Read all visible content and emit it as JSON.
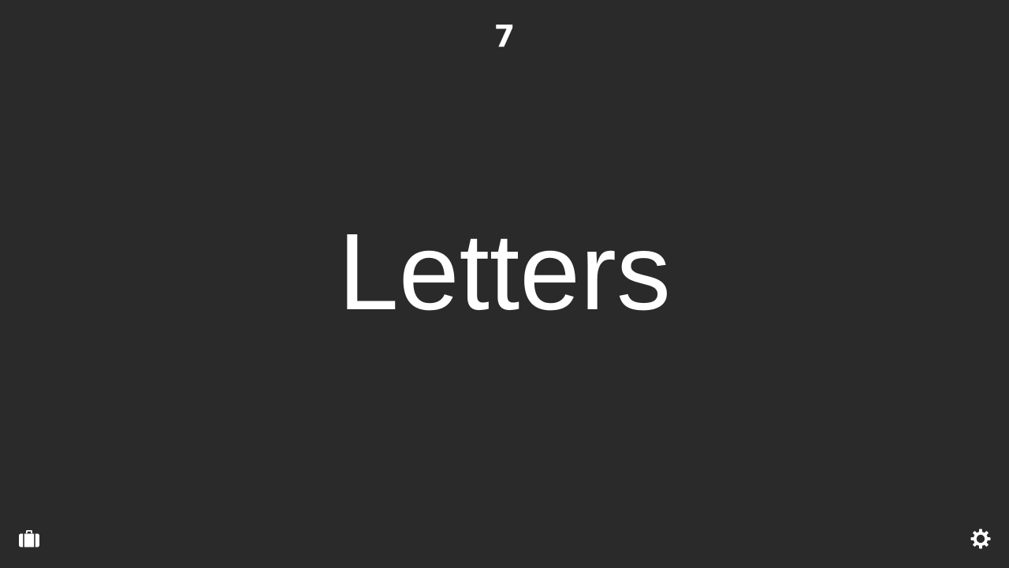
{
  "counter": {
    "value": "7"
  },
  "main": {
    "word": "Letters"
  },
  "controls": {
    "left_icon": "briefcase-icon",
    "right_icon": "gear-icon"
  },
  "colors": {
    "background": "#2a2a2a",
    "foreground": "#ffffff"
  }
}
